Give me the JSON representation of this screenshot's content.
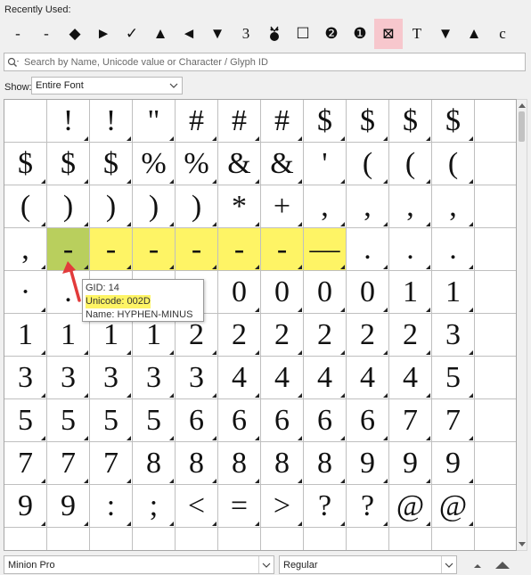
{
  "recently_used": {
    "label": "Recently Used:",
    "glyphs": [
      "-",
      "-",
      "◆",
      "►",
      "✓",
      "▲",
      "◄",
      "▼",
      "3",
      "",
      "☐",
      "❷",
      "❶",
      "⊠",
      "T",
      "▼",
      "▲",
      "c"
    ]
  },
  "search": {
    "placeholder": "Search by Name, Unicode value or Character / Glyph ID"
  },
  "show": {
    "label": "Show:",
    "value": "Entire Font"
  },
  "glyph_grid": [
    "",
    "!",
    "!",
    "\"",
    "#",
    "#",
    "#",
    "$",
    "$",
    "$",
    "$",
    "",
    "$",
    "$",
    "$",
    "%",
    "%",
    "&",
    "&",
    "'",
    "(",
    "(",
    "(",
    "",
    "(",
    ")",
    ")",
    ")",
    ")",
    "*",
    "+",
    ",",
    ",",
    ",",
    ",",
    "",
    ",",
    "-",
    "-",
    "-",
    "-",
    "-",
    "-",
    "—",
    ".",
    ".",
    ".",
    "",
    "·",
    ".",
    "",
    "",
    "",
    "0",
    "0",
    "0",
    "0",
    "1",
    "1",
    "",
    "1",
    "1",
    "1",
    "1",
    "2",
    "2",
    "2",
    "2",
    "2",
    "2",
    "3",
    "",
    "3",
    "3",
    "3",
    "3",
    "3",
    "4",
    "4",
    "4",
    "4",
    "4",
    "5",
    "",
    "5",
    "5",
    "5",
    "5",
    "6",
    "6",
    "6",
    "6",
    "6",
    "7",
    "7",
    "",
    "7",
    "7",
    "7",
    "8",
    "8",
    "8",
    "8",
    "8",
    "9",
    "9",
    "9",
    "",
    "9",
    "9",
    ":",
    ";",
    "<",
    "=",
    ">",
    "?",
    "?",
    "@",
    "@",
    "",
    "",
    "",
    "",
    "",
    "",
    "",
    "",
    "",
    "",
    "",
    "",
    ""
  ],
  "tooltip": {
    "gid": "GID: 14",
    "unicode": "Unicode: 002D",
    "name": "Name: HYPHEN-MINUS"
  },
  "bottom": {
    "font_family": "Minion Pro",
    "font_style": "Regular"
  },
  "colors": {
    "highlight": "#fef465",
    "selected": "#b9cf5d",
    "recent_selected": "#f7c7cd",
    "arrow": "#e23b3b"
  }
}
